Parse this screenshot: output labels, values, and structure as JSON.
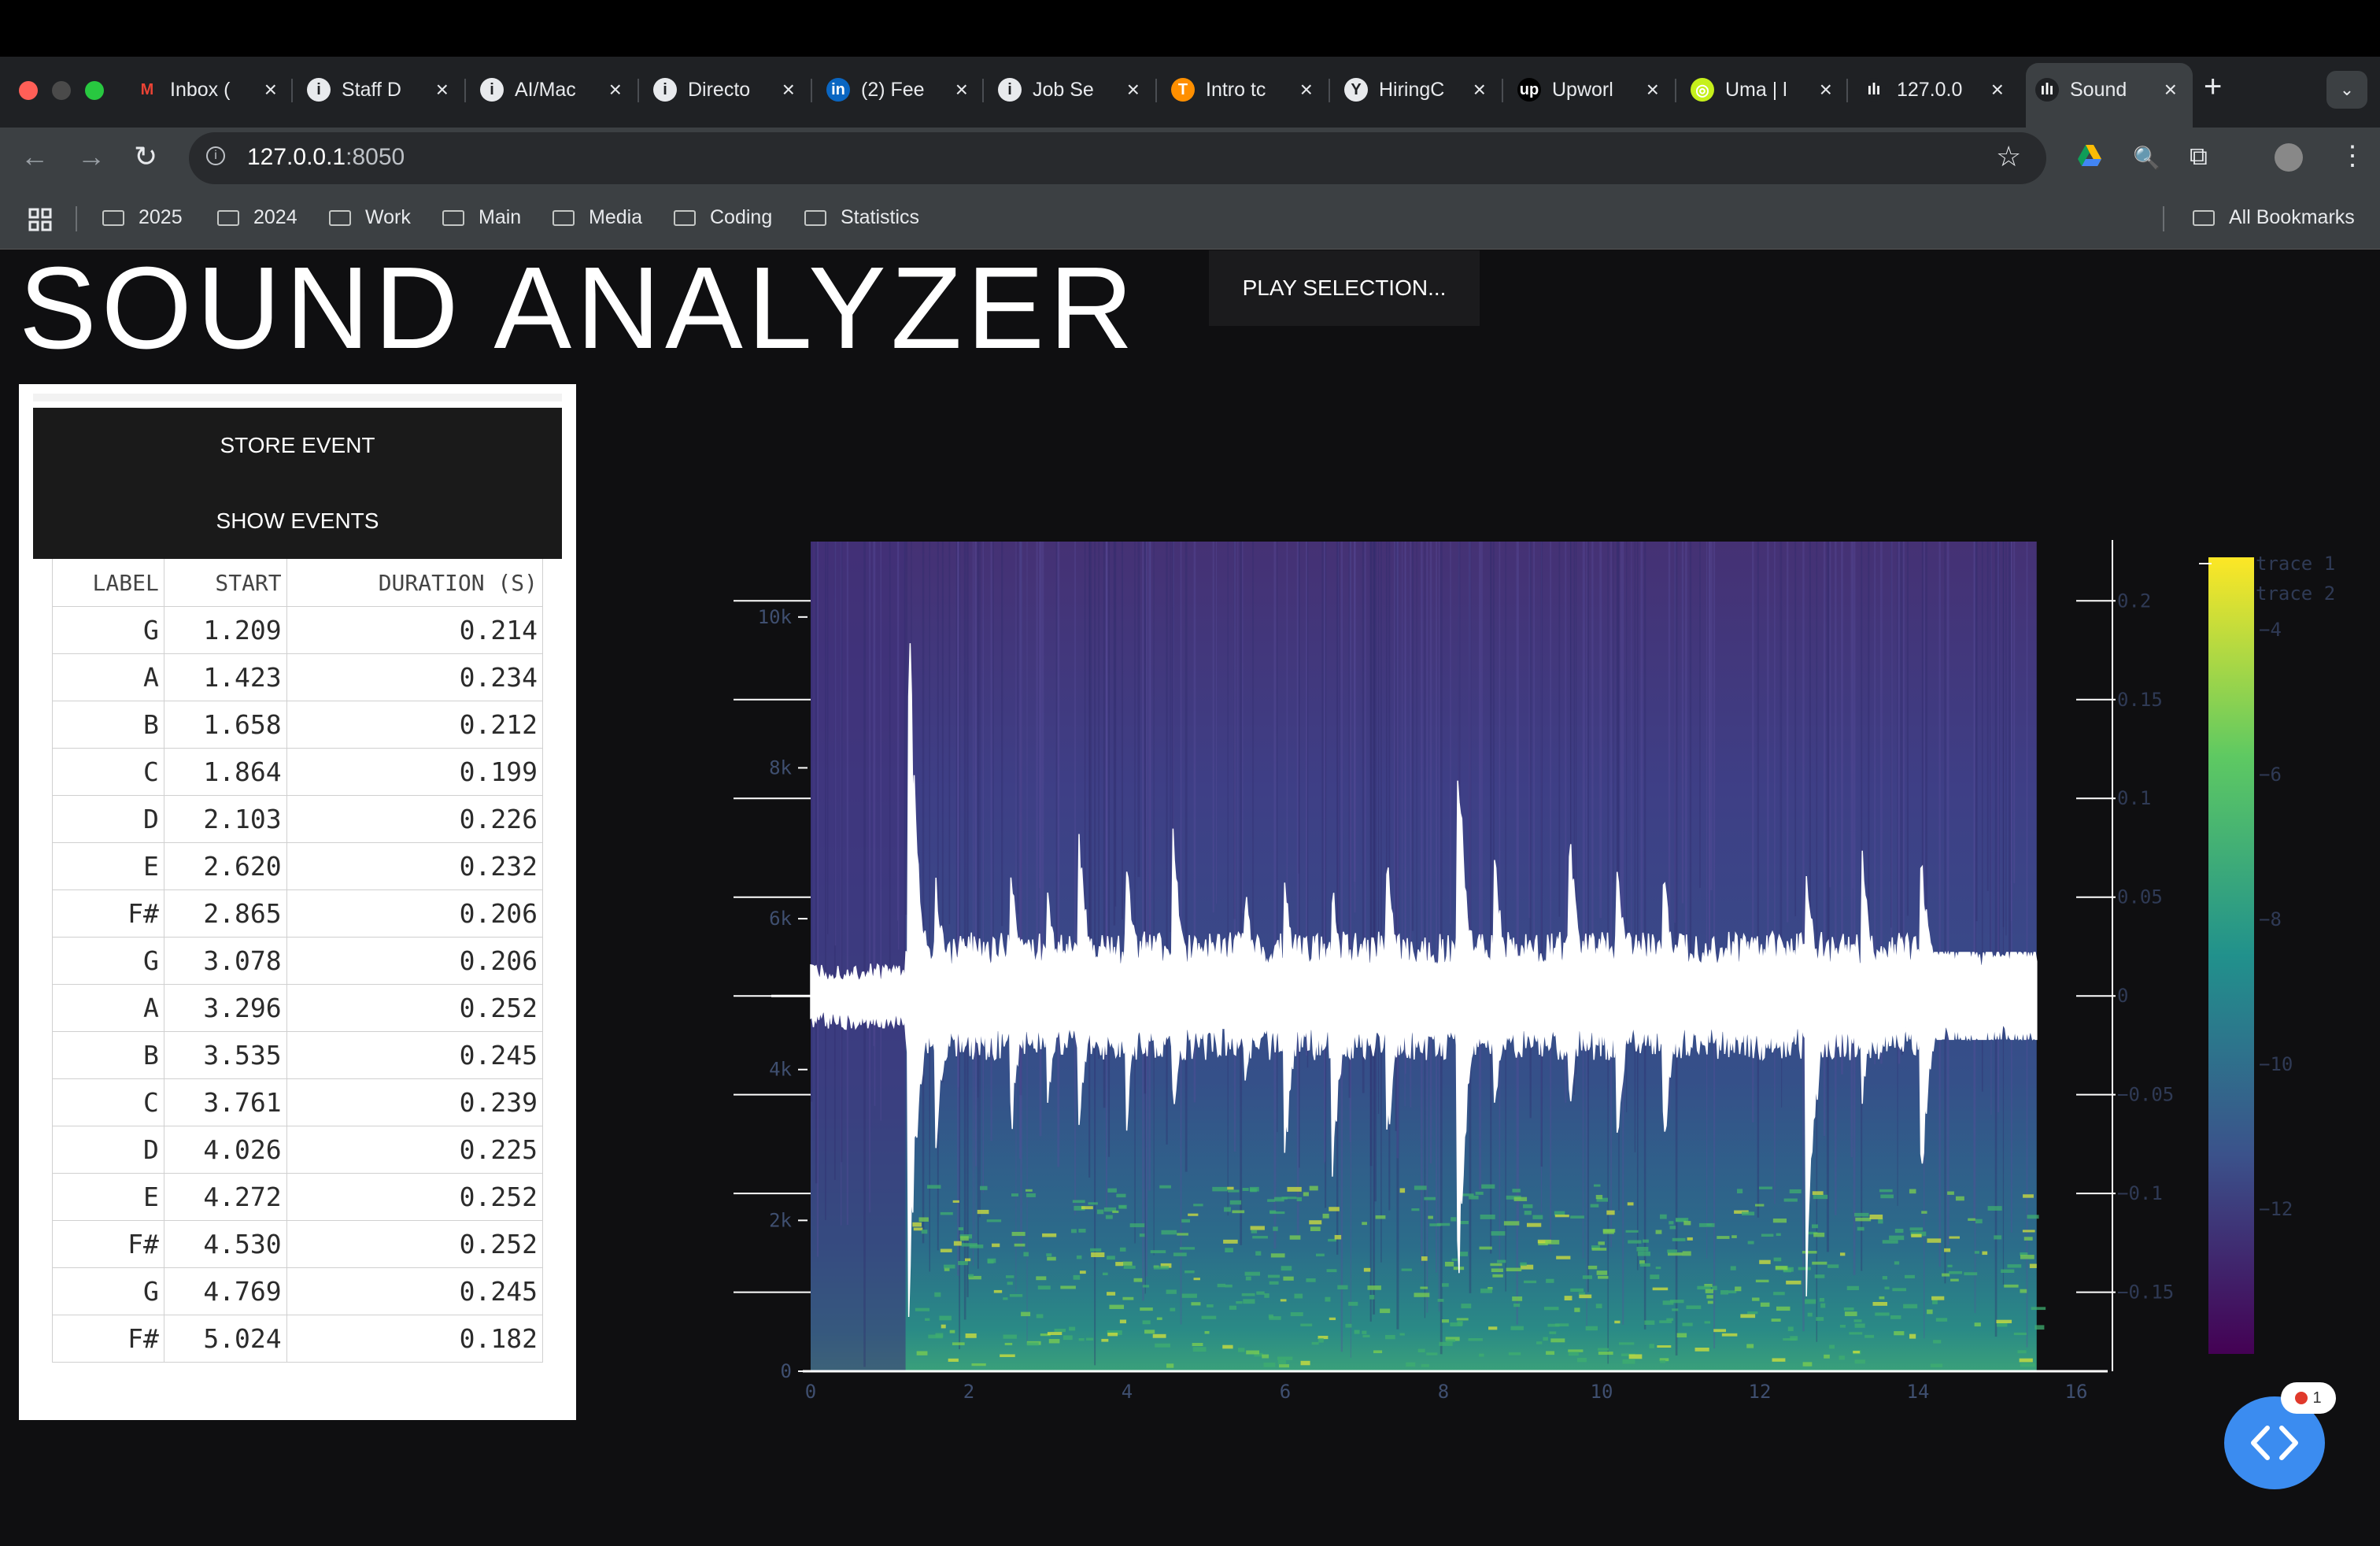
{
  "browser": {
    "tabs": [
      {
        "title": "Inbox (",
        "icon": "gmail-icon"
      },
      {
        "title": "Staff D",
        "icon": "info-icon"
      },
      {
        "title": "AI/Mac",
        "icon": "info-icon"
      },
      {
        "title": "Directo",
        "icon": "info-icon"
      },
      {
        "title": "(2) Fee",
        "icon": "linkedin-icon"
      },
      {
        "title": "Job Se",
        "icon": "info-icon"
      },
      {
        "title": "Intro tc",
        "icon": "tensorflow-icon"
      },
      {
        "title": "HiringC",
        "icon": "hiring-icon"
      },
      {
        "title": "Upworl",
        "icon": "upwork-icon"
      },
      {
        "title": "Uma | l",
        "icon": "uma-icon"
      },
      {
        "title": "127.0.0",
        "icon": "app-icon"
      },
      {
        "title": "Sound",
        "icon": "app-icon"
      }
    ],
    "url_host": "127.0.0.1",
    "url_port": ":8050",
    "bookmarks": [
      "2025",
      "2024",
      "Work",
      "Main",
      "Media",
      "Coding",
      "Statistics"
    ],
    "all_bookmarks": "All Bookmarks"
  },
  "page": {
    "title": "SOUND ANALYZER",
    "play_button": "PLAY SELECTION...",
    "store_button": "STORE EVENT",
    "show_button": "SHOW EVENTS"
  },
  "table": {
    "headers": [
      "LABEL",
      "START",
      "DURATION (S)"
    ],
    "rows": [
      [
        "G",
        "1.209",
        "0.214"
      ],
      [
        "A",
        "1.423",
        "0.234"
      ],
      [
        "B",
        "1.658",
        "0.212"
      ],
      [
        "C",
        "1.864",
        "0.199"
      ],
      [
        "D",
        "2.103",
        "0.226"
      ],
      [
        "E",
        "2.620",
        "0.232"
      ],
      [
        "F#",
        "2.865",
        "0.206"
      ],
      [
        "G",
        "3.078",
        "0.206"
      ],
      [
        "A",
        "3.296",
        "0.252"
      ],
      [
        "B",
        "3.535",
        "0.245"
      ],
      [
        "C",
        "3.761",
        "0.239"
      ],
      [
        "D",
        "4.026",
        "0.225"
      ],
      [
        "E",
        "4.272",
        "0.252"
      ],
      [
        "F#",
        "4.530",
        "0.252"
      ],
      [
        "G",
        "4.769",
        "0.245"
      ],
      [
        "F#",
        "5.024",
        "0.182"
      ]
    ]
  },
  "chart_data": {
    "type": "heatmap",
    "overlay": "line",
    "xlim": [
      0,
      16
    ],
    "data_xmax": 15.5,
    "xticks": [
      0,
      2,
      4,
      6,
      8,
      10,
      12,
      14,
      16
    ],
    "ylim": [
      0,
      11000
    ],
    "yticks": [
      0,
      2000,
      4000,
      6000,
      8000,
      10000
    ],
    "ytick_labels": [
      "0",
      "2k",
      "4k",
      "6k",
      "8k",
      "10k"
    ],
    "y2lim": [
      -0.19,
      0.23
    ],
    "y2ticks": [
      -0.15,
      -0.1,
      -0.05,
      0,
      0.05,
      0.1,
      0.15,
      0.2
    ],
    "y2tick_labels": [
      "−0.15",
      "−0.1",
      "−0.05",
      "0",
      "0.05",
      "0.1",
      "0.15",
      "0.2"
    ],
    "legend": [
      "trace 1",
      "trace 2"
    ],
    "colorbar": {
      "range": [
        -14,
        -3
      ],
      "ticks": [
        -12,
        -10,
        -8,
        -6,
        -4
      ],
      "tick_labels": [
        "−12",
        "−10",
        "−8",
        "−6",
        "−4"
      ],
      "colorscale": "viridis"
    },
    "waveform_onset": 1.2,
    "waveform_peaks": [
      {
        "t": 1.25,
        "hi": 0.2,
        "lo": -0.17
      },
      {
        "t": 1.6,
        "hi": 0.06,
        "lo": -0.08
      },
      {
        "t": 2.55,
        "hi": 0.07,
        "lo": -0.07
      },
      {
        "t": 3.0,
        "hi": 0.06,
        "lo": -0.06
      },
      {
        "t": 3.4,
        "hi": 0.09,
        "lo": -0.07
      },
      {
        "t": 4.0,
        "hi": 0.08,
        "lo": -0.07
      },
      {
        "t": 4.6,
        "hi": 0.09,
        "lo": -0.06
      },
      {
        "t": 5.5,
        "hi": 0.06,
        "lo": -0.05
      },
      {
        "t": 6.0,
        "hi": 0.06,
        "lo": -0.09
      },
      {
        "t": 6.6,
        "hi": 0.06,
        "lo": -0.1
      },
      {
        "t": 7.3,
        "hi": 0.07,
        "lo": -0.08
      },
      {
        "t": 8.2,
        "hi": 0.13,
        "lo": -0.15
      },
      {
        "t": 8.65,
        "hi": 0.08,
        "lo": -0.07
      },
      {
        "t": 9.6,
        "hi": 0.09,
        "lo": -0.06
      },
      {
        "t": 10.2,
        "hi": 0.08,
        "lo": -0.08
      },
      {
        "t": 10.8,
        "hi": 0.06,
        "lo": -0.08
      },
      {
        "t": 12.6,
        "hi": 0.07,
        "lo": -0.17
      },
      {
        "t": 13.3,
        "hi": 0.08,
        "lo": -0.06
      },
      {
        "t": 14.05,
        "hi": 0.08,
        "lo": -0.1
      }
    ]
  },
  "fab": {
    "badge_count": "1"
  }
}
